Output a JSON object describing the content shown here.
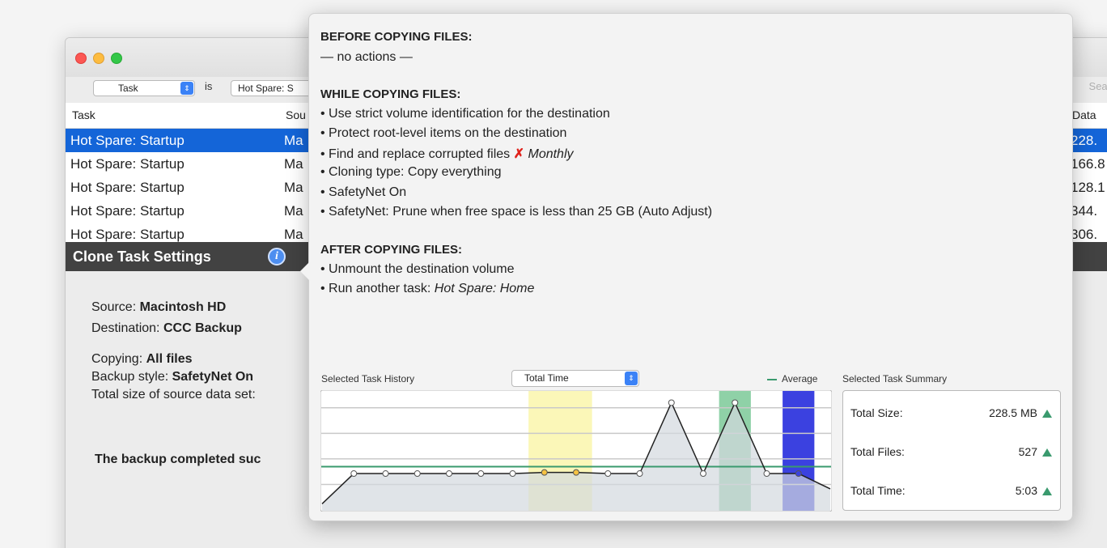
{
  "filter": {
    "field": "Task",
    "operator": "is",
    "value": "Hot Spare: S",
    "search_placeholder": "Sear"
  },
  "table": {
    "columns": [
      "Task",
      "Sou",
      "Data"
    ],
    "rows": [
      {
        "task": "Hot Spare: Startup",
        "source": "Ma",
        "data": "228.",
        "selected": true
      },
      {
        "task": "Hot Spare: Startup",
        "source": "Ma",
        "data": "166.8",
        "selected": false
      },
      {
        "task": "Hot Spare: Startup",
        "source": "Ma",
        "data": "128.1",
        "selected": false
      },
      {
        "task": "Hot Spare: Startup",
        "source": "Ma",
        "data": "344.",
        "selected": false
      },
      {
        "task": "Hot Spare: Startup",
        "source": "Ma",
        "data": "306.",
        "selected": false
      }
    ]
  },
  "settings": {
    "title": "Clone Task Settings",
    "source_label": "Source:",
    "source_value": "Macintosh HD",
    "destination_label": "Destination:",
    "destination_value": "CCC Backup",
    "copying_label": "Copying:",
    "copying_value": "All files",
    "backup_style_label": "Backup style:",
    "backup_style_value": "SafetyNet On",
    "total_size_label": "Total size of source data set:",
    "status_text": "The backup completed suc"
  },
  "popover": {
    "before": {
      "heading": "BEFORE COPYING FILES:",
      "lines": [
        "— no actions —"
      ]
    },
    "while": {
      "heading": "WHILE COPYING FILES:",
      "lines": [
        "• Use strict volume identification for the destination",
        "• Protect root-level items on the destination",
        "• Find and replace corrupted files",
        "• Cloning type: Copy everything",
        "• SafetyNet On",
        "• SafetyNet: Prune when free space is less than 25 GB (Auto Adjust)"
      ],
      "corrupted_mark": "✗",
      "corrupted_schedule": "Monthly"
    },
    "after": {
      "heading": "AFTER COPYING FILES:",
      "line1": "• Unmount the destination volume",
      "line2_prefix": "• Run another task: ",
      "line2_task": "Hot Spare: Home"
    },
    "history_label": "Selected Task History",
    "history_metric": "Total Time",
    "average_label": "Average",
    "summary_label": "Selected Task Summary",
    "summary": [
      {
        "key": "Total Size:",
        "value": "228.5 MB"
      },
      {
        "key": "Total Files:",
        "value": "527"
      },
      {
        "key": "Total Time:",
        "value": "5:03"
      }
    ]
  },
  "chart_data": {
    "type": "area",
    "title": "",
    "xlabel": "",
    "ylabel": "",
    "ylim": [
      0,
      10
    ],
    "values": [
      1.6,
      9.5,
      9.5,
      9.5,
      9.5,
      9.5,
      9.5,
      9.8,
      9.8,
      9.5,
      9.5,
      28,
      9.5,
      28,
      9.5,
      9.5,
      5.5
    ],
    "marker_colors": [
      "#ffffff",
      "#ffffff",
      "#ffffff",
      "#ffffff",
      "#ffffff",
      "#ffffff",
      "#ffffff",
      "#f5c242",
      "#f5c242",
      "#ffffff",
      "#ffffff",
      "#ffffff",
      "#ffffff",
      "#ffffff",
      "#ffffff",
      "#3b41e0",
      "#3b41e0"
    ],
    "highlight_bands": [
      {
        "from": 6.5,
        "to": 8.5,
        "color": "#fbf7b8"
      },
      {
        "from": 12.5,
        "to": 13.5,
        "color": "#8fd1a7"
      },
      {
        "from": 14.5,
        "to": 15.5,
        "color": "#3b41e0"
      }
    ],
    "average": 11.3,
    "y_max": 30,
    "grid": true,
    "colors": {
      "line": "#222222",
      "fill": "#d3d9de",
      "average": "#3a9a6e"
    }
  }
}
